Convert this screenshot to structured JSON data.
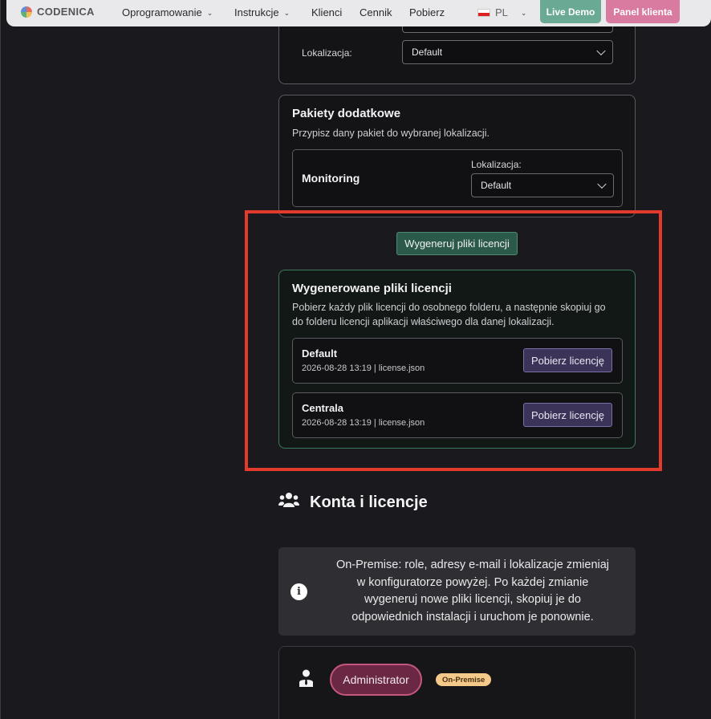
{
  "navbar": {
    "logo": "CODENICA",
    "items": [
      {
        "label": "Oprogramowanie",
        "dropdown": true
      },
      {
        "label": "Instrukcje",
        "dropdown": true
      },
      {
        "label": "Klienci",
        "dropdown": false
      },
      {
        "label": "Cennik",
        "dropdown": false
      },
      {
        "label": "Pobierz",
        "dropdown": false
      }
    ],
    "language": "PL",
    "live_demo": "Live Demo",
    "client_panel": "Panel klienta",
    "colors": {
      "live_demo": "#6aa994",
      "client_panel": "#d97aa0"
    }
  },
  "top_card": {
    "location_label": "Lokalizacja:",
    "location_value": "Default"
  },
  "addons": {
    "title": "Pakiety dodatkowe",
    "description": "Przypisz dany pakiet do wybranej lokalizacji.",
    "package": {
      "name": "Monitoring",
      "location_label": "Lokalizacja:",
      "location_value": "Default"
    }
  },
  "generate_button": "Wygeneruj pliki licencji",
  "generated": {
    "title": "Wygenerowane pliki licencji",
    "description_line1": "Pobierz każdy plik licencji do osobnego folderu, a następnie skopiuj go",
    "description_line2": "do folderu licencji aplikacji właściwego dla danej lokalizacji.",
    "files": [
      {
        "name": "Default",
        "meta": "2026-08-28 13:19 | license.json",
        "button": "Pobierz licencję"
      },
      {
        "name": "Centrala",
        "meta": "2026-08-28 13:19 | license.json",
        "button": "Pobierz licencję"
      }
    ]
  },
  "accounts": {
    "title": "Konta i licencje",
    "info_line1": "On-Premise: role, adresy e-mail i lokalizacje zmieniaj",
    "info_line2": "w konfiguratorze powyżej. Po każdej zmianie",
    "info_line3": "wygeneruj nowe pliki licencji, skopiuj je do",
    "info_line4": "odpowiednich instalacji i uruchom je ponownie.",
    "role": "Administrator",
    "badge": "On-Premise"
  },
  "highlight_color": "#e33a2e"
}
